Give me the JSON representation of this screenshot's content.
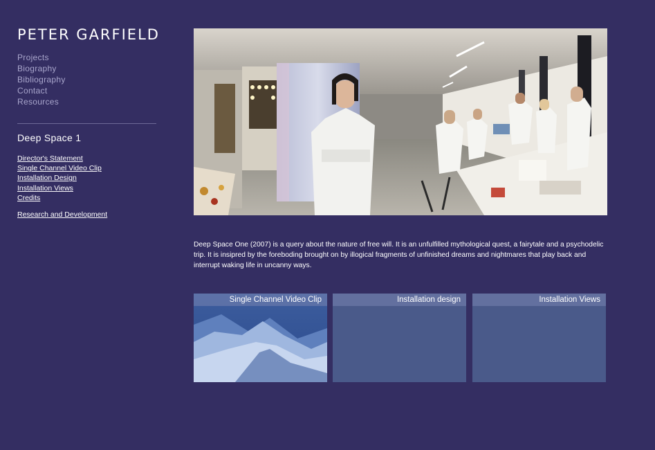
{
  "site": {
    "title": "PETER GARFIELD"
  },
  "main_nav": {
    "items": [
      "Projects",
      "Biography",
      "Bibliography",
      "Contact",
      "Resources"
    ]
  },
  "section": {
    "title": "Deep Space 1"
  },
  "sub_nav": {
    "items": [
      "Director's Statement",
      "Single Channel Video Clip",
      "Installation Design",
      "Installation Views",
      "Credits"
    ],
    "extra": "Research and Development"
  },
  "hero": {
    "icon": "laboratory-photo"
  },
  "description": {
    "text": "Deep Space One (2007) is a query about the nature of free will. It is an unfulfilled mythological quest, a fairytale and a psychodelic trip. It is insipred by the foreboding brought on by illogical fragments of unfinished dreams and nightmares that play back and interrupt waking life in uncanny ways."
  },
  "thumbnails": [
    {
      "label": "Single Channel Video Clip"
    },
    {
      "label": "Installation design"
    },
    {
      "label": "Installation Views"
    }
  ],
  "colors": {
    "background": "#342e62",
    "nav_text": "#a9a6cc",
    "thumb_panel": "#4a5a8a"
  }
}
